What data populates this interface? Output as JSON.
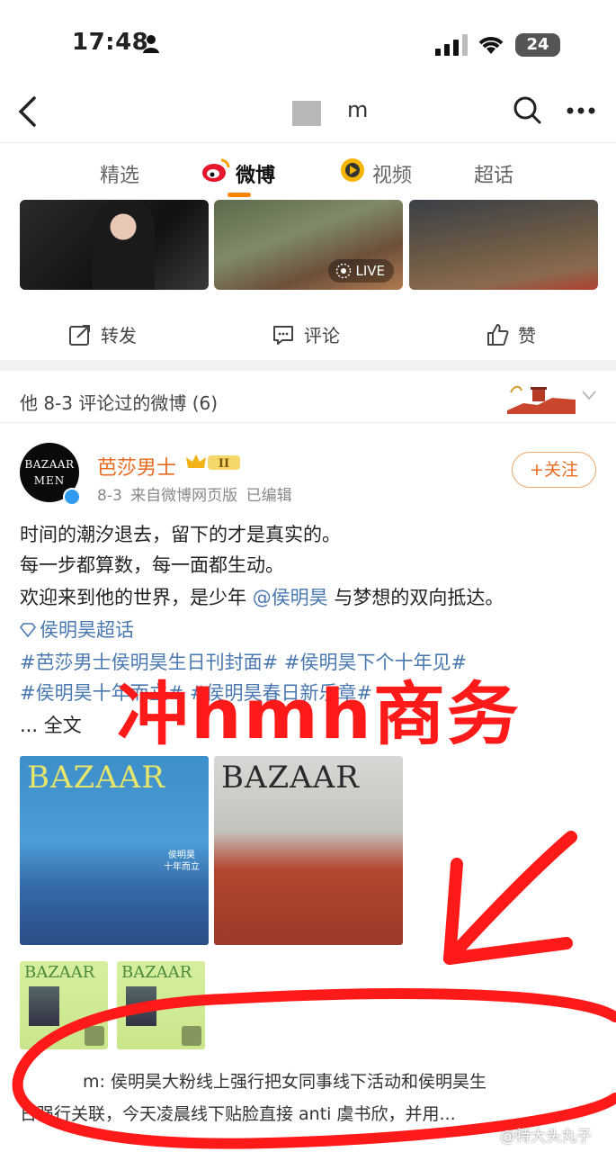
{
  "status": {
    "time": "17:48",
    "battery": "24"
  },
  "nav": {
    "title_suffix": "m"
  },
  "tabs": [
    {
      "label": "精选"
    },
    {
      "label": "微博"
    },
    {
      "label": "视频"
    },
    {
      "label": "超话"
    }
  ],
  "media": {
    "live_label": "LIVE"
  },
  "actions": {
    "repost": "转发",
    "comment": "评论",
    "like": "赞"
  },
  "comment_header": {
    "label": "他 8-3 评论过的微博 (6)"
  },
  "post": {
    "author": "芭莎男士",
    "badge_level": "II",
    "meta": "8-3  来自微博网页版  已编辑",
    "follow": "+关注",
    "avatar_line1": "BAZAAR",
    "avatar_line2": "MEN",
    "line1": "时间的潮汐退去，留下的才是真实的。",
    "line2": "每一步都算数，每一面都生动。",
    "line3_pre": "欢迎来到他的世界，是少年 ",
    "line3_mention": "@侯明昊",
    "line3_post": " 与梦想的双向抵达。",
    "supertopic": "侯明昊超话",
    "hashtags1": "#芭莎男士侯明昊生日刊封面#  #侯明昊下个十年见#",
    "hashtags2": "#侯明昊十年而立#  #侯明昊春日新乐章#",
    "more": "... 全文",
    "cover_title": "BAZAAR",
    "cover_sub": "侯明昊\n十年而立"
  },
  "overlay": {
    "text": "冲hmh商务"
  },
  "ad": {
    "line1": "m: 侯明昊大粉线上强行把女同事线下活动和侯明昊生",
    "line2": "日强行关联，今天凌晨线下贴脸直接 anti 虞书欣，并用..."
  },
  "watermark": "@特大头丸子",
  "colors": {
    "accent": "#ff8200",
    "author": "#e86b1f",
    "link": "#4a78b0",
    "annotation_red": "#ff1a1a"
  }
}
